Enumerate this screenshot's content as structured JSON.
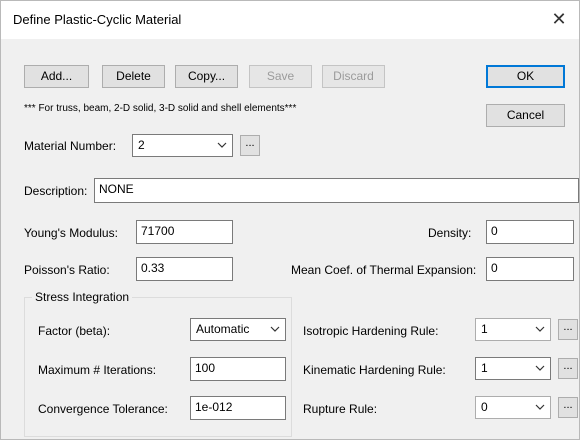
{
  "window": {
    "title": "Define Plastic-Cyclic Material",
    "close_glyph": "✕"
  },
  "toolbar": {
    "add_label": "Add...",
    "delete_label": "Delete",
    "copy_label": "Copy...",
    "save_label": "Save",
    "discard_label": "Discard"
  },
  "dialog_buttons": {
    "ok_label": "OK",
    "cancel_label": "Cancel"
  },
  "note": "*** For truss, beam, 2-D solid, 3-D solid and shell elements***",
  "material_number": {
    "label": "Material Number:",
    "value": "2",
    "more_label": "..."
  },
  "description": {
    "label": "Description:",
    "value": "NONE"
  },
  "youngs_modulus": {
    "label": "Young's Modulus:",
    "value": "71700"
  },
  "poissons_ratio": {
    "label": "Poisson's Ratio:",
    "value": "0.33"
  },
  "density": {
    "label": "Density:",
    "value": "0"
  },
  "thermal_expansion": {
    "label": "Mean Coef. of Thermal Expansion:",
    "value": "0"
  },
  "stress_integration": {
    "title": "Stress Integration",
    "factor": {
      "label": "Factor (beta):",
      "value": "Automatic"
    },
    "max_iterations": {
      "label": "Maximum # Iterations:",
      "value": "100"
    },
    "convergence": {
      "label": "Convergence Tolerance:",
      "value": "1e-012"
    }
  },
  "isotropic_rule": {
    "label": "Isotropic Hardening Rule:",
    "value": "1",
    "more_label": "..."
  },
  "kinematic_rule": {
    "label": "Kinematic Hardening Rule:",
    "value": "1",
    "more_label": "..."
  },
  "rupture_rule": {
    "label": "Rupture Rule:",
    "value": "0",
    "more_label": "..."
  },
  "colors": {
    "accent": "#0078d7",
    "face": "#f0f0f0",
    "disabled_text": "#9b9b9b"
  }
}
